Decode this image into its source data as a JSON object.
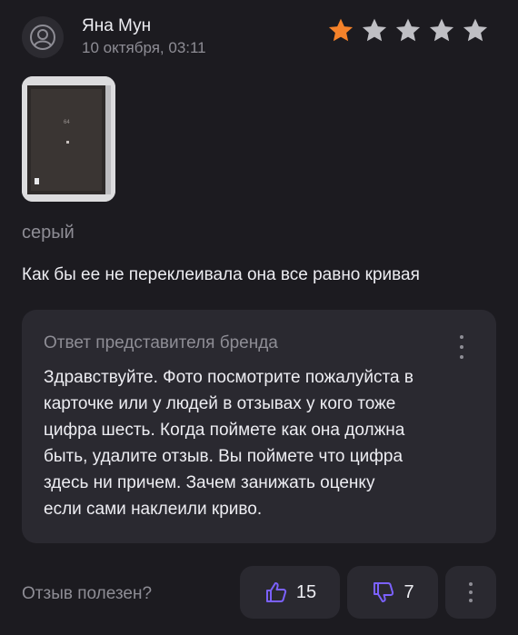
{
  "author": {
    "name": "Яна Мун",
    "date": "10 октября, 03:11"
  },
  "rating": {
    "value": 1,
    "max": 5,
    "filled_color": "#f5822a",
    "empty_color": "#bfbfc4"
  },
  "review": {
    "variant": "серый",
    "text": "Как бы ее не переклеивала она все равно  кривая",
    "photo_icon": "door-photo"
  },
  "reply": {
    "title": "Ответ представителя бренда",
    "lines": [
      "Здравствуйте. Фото посмотрите пожалуйста в",
      "карточке или у людей в отзывах у кого тоже",
      "цифра шесть. Когда поймете как она должна",
      "быть, удалите отзыв. Вы поймете что цифра",
      "здесь ни причем. Зачем занижать оценку",
      "если сами наклеили криво."
    ]
  },
  "feedback": {
    "label": "Отзыв полезен?",
    "likes": "15",
    "dislikes": "7",
    "accent": "#7b61ff"
  }
}
